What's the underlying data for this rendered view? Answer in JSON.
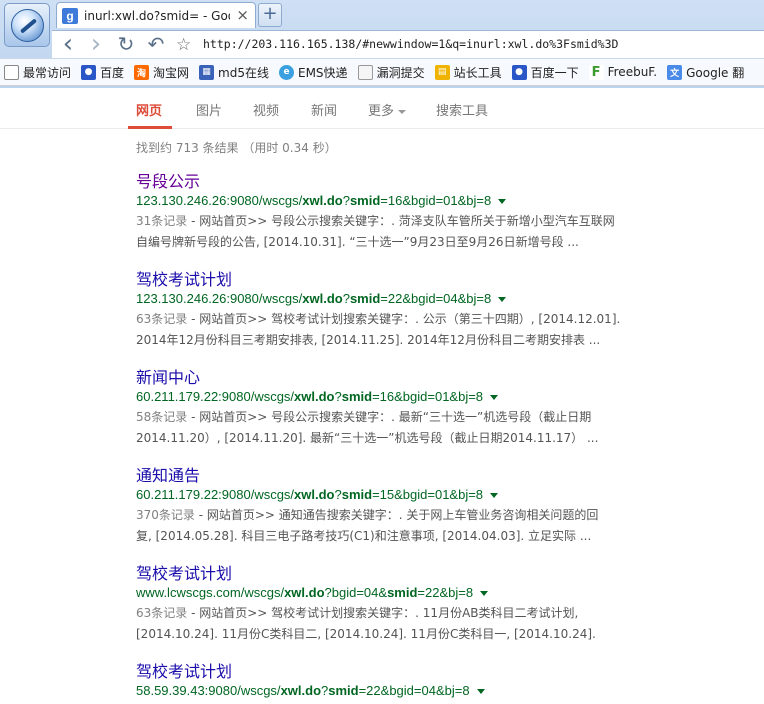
{
  "browser": {
    "tab_title": "inurl:xwl.do?smid= - Google",
    "tab_close": "×",
    "new_tab": "+",
    "address": "http://203.116.165.138/#newwindow=1&q=inurl:xwl.do%3Fsmid%3D",
    "nav": {
      "back": "‹",
      "forward": "›",
      "reload": "↻",
      "undo": "↶",
      "star": "☆"
    },
    "bookmarks": [
      {
        "label": "最常访问",
        "icon": "page-icon"
      },
      {
        "label": "百度",
        "icon": "baidu-paw-icon"
      },
      {
        "label": "淘宝网",
        "icon": "taobao-icon"
      },
      {
        "label": "md5在线",
        "icon": "md5-icon"
      },
      {
        "label": "EMS快递",
        "icon": "ems-icon"
      },
      {
        "label": "漏洞提交",
        "icon": "folder-icon"
      },
      {
        "label": "站长工具",
        "icon": "tools-icon"
      },
      {
        "label": "百度一下",
        "icon": "baidu-paw-icon"
      },
      {
        "label": "FreebuF.",
        "icon": "freebuf-icon"
      },
      {
        "label": "Google 翻",
        "icon": "google-translate-icon"
      }
    ]
  },
  "google_nav": {
    "web": "网页",
    "images": "图片",
    "videos": "视频",
    "news": "新闻",
    "more": "更多",
    "search_tools": "搜索工具"
  },
  "stats": "找到约 713 条结果 （用时 0.34 秒）",
  "results": [
    {
      "title": "号段公示",
      "visited": true,
      "url_pre": "123.130.246.26:9080/wscgs/",
      "url_b1": "xwl.do",
      "url_mid": "?",
      "url_b2": "smid",
      "url_post": "=16&bgid=01&bj=8",
      "count": "31条记录",
      "snippet_line1": " - 网站首页>> 号段公示搜索关键字：. 菏泽支队车管所关于新增小型汽车互联网",
      "snippet_line2": "自编号牌新号段的公告, [2014.10.31]. “三十选一”9月23日至9月26日新增号段 ..."
    },
    {
      "title": "驾校考试计划",
      "visited": false,
      "url_pre": "123.130.246.26:9080/wscgs/",
      "url_b1": "xwl.do",
      "url_mid": "?",
      "url_b2": "smid",
      "url_post": "=22&bgid=04&bj=8",
      "count": "63条记录",
      "snippet_line1": " - 网站首页>> 驾校考试计划搜索关键字：. 公示（第三十四期）, [2014.12.01].",
      "snippet_line2": "2014年12月份科目三考期安排表, [2014.11.25]. 2014年12月份科目二考期安排表 ..."
    },
    {
      "title": "新闻中心",
      "visited": false,
      "url_pre": "60.211.179.22:9080/wscgs/",
      "url_b1": "xwl.do",
      "url_mid": "?",
      "url_b2": "smid",
      "url_post": "=16&bgid=01&bj=8",
      "count": "58条记录",
      "snippet_line1": " - 网站首页>> 号段公示搜索关键字：. 最新“三十选一”机选号段（截止日期",
      "snippet_line2": "2014.11.20）, [2014.11.20]. 最新“三十选一”机选号段（截止日期2014.11.17） ..."
    },
    {
      "title": "通知通告",
      "visited": false,
      "url_pre": "60.211.179.22:9080/wscgs/",
      "url_b1": "xwl.do",
      "url_mid": "?",
      "url_b2": "smid",
      "url_post": "=15&bgid=01&bj=8",
      "count": "370条记录",
      "snippet_line1": " - 网站首页>> 通知通告搜索关键字：. 关于网上车管业务咨询相关问题的回",
      "snippet_line2": "复, [2014.05.28]. 科目三电子路考技巧(C1)和注意事项, [2014.04.03]. 立足实际 ..."
    },
    {
      "title": "驾校考试计划",
      "visited": false,
      "url_pre": "www.lcwscgs.com/wscgs/",
      "url_b1": "xwl.do",
      "url_mid": "?bgid=04&",
      "url_b2": "smid",
      "url_post": "=22&bj=8",
      "count": "63条记录",
      "snippet_line1": " - 网站首页>> 驾校考试计划搜索关键字：. 11月份AB类科目二考试计划,",
      "snippet_line2": "[2014.10.24]. 11月份C类科目二, [2014.10.24]. 11月份C类科目一, [2014.10.24]."
    },
    {
      "title": "驾校考试计划",
      "visited": false,
      "url_pre": "58.59.39.43:9080/wscgs/",
      "url_b1": "xwl.do",
      "url_mid": "?",
      "url_b2": "smid",
      "url_post": "=22&bgid=04&bj=8",
      "count": "",
      "snippet_line1": "",
      "snippet_line2": ""
    }
  ]
}
